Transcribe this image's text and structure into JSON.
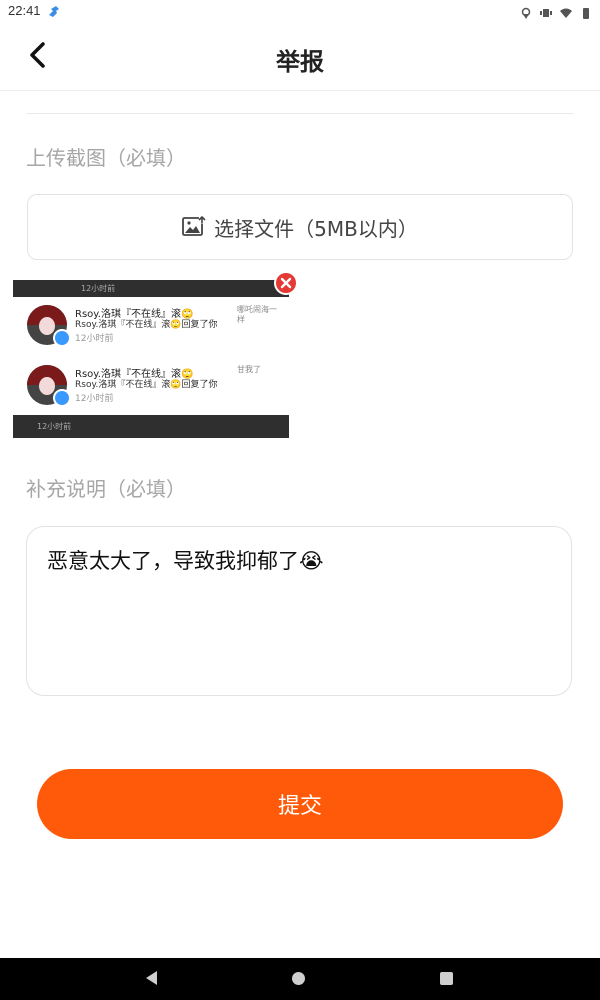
{
  "status_bar": {
    "time": "22:41"
  },
  "header": {
    "title": "举报"
  },
  "screenshot_section": {
    "label": "上传截图（必填）"
  },
  "file_select": {
    "label": "选择文件（5MB以内）",
    "icon": "image-upload-icon"
  },
  "thumbnail": {
    "top_time": "12小时前",
    "rows": [
      {
        "name": "Rsoy.洛琪『不在线』滚🙄",
        "sub": "Rsoy.洛琪『不在线』滚🙄回复了你",
        "time": "12小时前",
        "right": "哪吒闹海一样"
      },
      {
        "name": "Rsoy.洛琪『不在线』滚🙄",
        "sub": "Rsoy.洛琪『不在线』滚🙄回复了你",
        "time": "12小时前",
        "right": "甘我了"
      }
    ],
    "bottom_time": "12小时前"
  },
  "description_section": {
    "label": "补充说明（必填）",
    "value": "恶意太大了，导致我抑郁了😭"
  },
  "submit": {
    "label": "提交"
  },
  "colors": {
    "accent": "#ff5a0a",
    "close": "#e53935"
  }
}
